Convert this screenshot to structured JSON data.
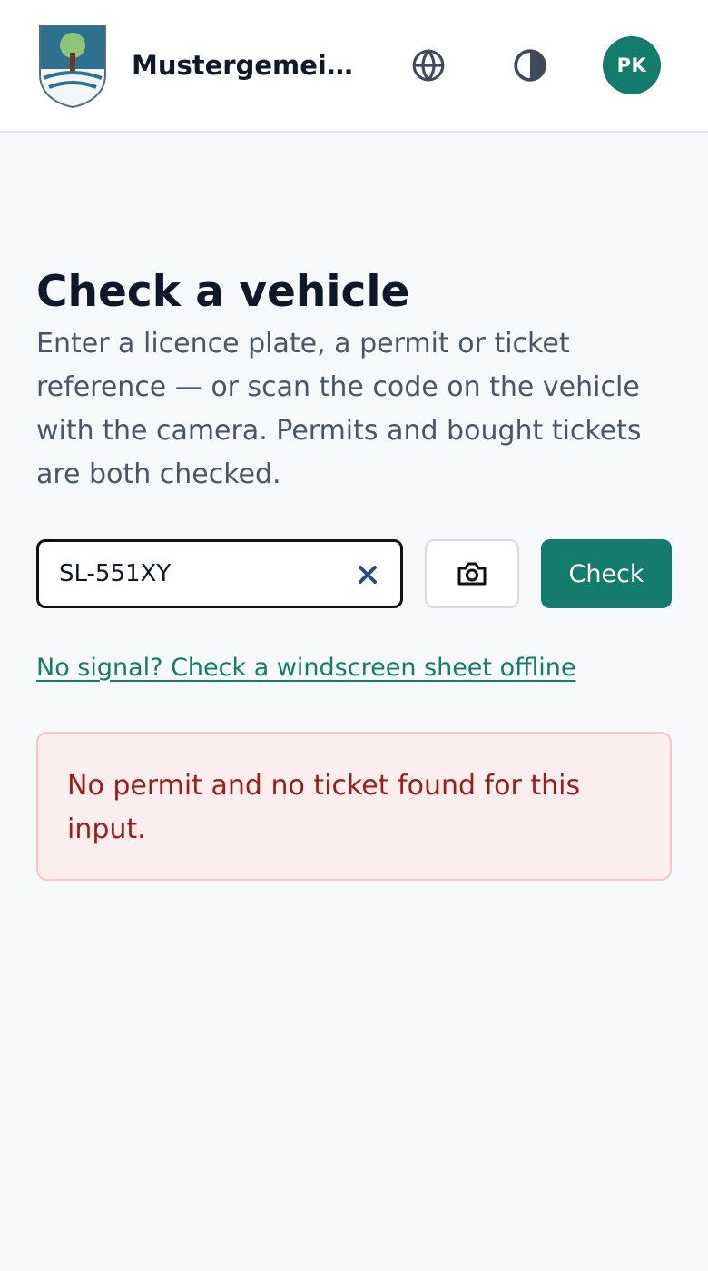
{
  "header": {
    "org_name": "Mustergemeinde",
    "icons": {
      "crest": "municipal-crest-logo",
      "language": "globe-icon",
      "contrast": "contrast-icon"
    },
    "avatar_initials": "PK"
  },
  "main": {
    "title": "Check a vehicle",
    "description": "Enter a licence plate, a permit or ticket reference — or scan the code on the vehicle with the camera. Permits and bought tickets are both checked.",
    "search": {
      "value": "SL-551XY",
      "clear_icon": "close-icon",
      "camera_icon": "camera-icon"
    },
    "check_label": "Check",
    "offline_link": "No signal? Check a windscreen sheet offline",
    "alert": {
      "message": "No permit and no ticket found for this input."
    }
  },
  "colors": {
    "accent": "#137c6c",
    "alert_text": "#9b1c1c",
    "alert_bg": "#fdeeee",
    "page_bg": "#f7f8fa"
  }
}
